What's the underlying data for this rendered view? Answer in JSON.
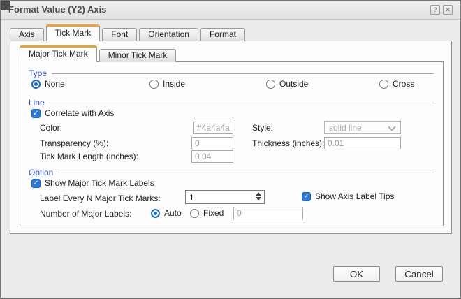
{
  "window": {
    "title": "Format Value (Y2) Axis"
  },
  "icons": {
    "help": "?",
    "close": "✕",
    "check": "✓"
  },
  "tabs": [
    {
      "label": "Axis"
    },
    {
      "label": "Tick Mark"
    },
    {
      "label": "Font"
    },
    {
      "label": "Orientation"
    },
    {
      "label": "Format"
    }
  ],
  "active_tab": "Tick Mark",
  "subtabs": [
    {
      "label": "Major Tick Mark"
    },
    {
      "label": "Minor Tick Mark"
    }
  ],
  "active_subtab": "Major Tick Mark",
  "type_group": {
    "title": "Type",
    "options": [
      {
        "label": "None",
        "selected": true
      },
      {
        "label": "Inside",
        "selected": false
      },
      {
        "label": "Outside",
        "selected": false
      },
      {
        "label": "Cross",
        "selected": false
      }
    ]
  },
  "line_group": {
    "title": "Line",
    "correlate": {
      "label": "Correlate with Axis",
      "checked": true
    },
    "color": {
      "label": "Color:",
      "swatch": "#4a4a4a",
      "swatch_style": "background:#4a4a4a",
      "value": "#4a4a4a"
    },
    "style": {
      "label": "Style:",
      "value": "solid line",
      "disabled": true
    },
    "transparency": {
      "label": "Transparency (%):",
      "value": "0"
    },
    "thickness": {
      "label": "Thickness (inches):",
      "value": "0.01"
    },
    "tick_length": {
      "label": "Tick Mark Length (inches):",
      "value": "0.04"
    }
  },
  "option_group": {
    "title": "Option",
    "show_labels": {
      "label": "Show Major Tick Mark Labels",
      "checked": true
    },
    "label_every": {
      "label": "Label Every N Major Tick Marks:",
      "value": "1"
    },
    "axis_tips": {
      "label": "Show Axis Label Tips",
      "checked": true
    },
    "major_labels": {
      "label": "Number of Major Labels:",
      "auto": {
        "label": "Auto",
        "selected": true
      },
      "fixed": {
        "label": "Fixed",
        "selected": false
      },
      "fixed_value": "0"
    }
  },
  "buttons": {
    "ok": "OK",
    "cancel": "Cancel"
  },
  "colors": {
    "accent_blue": "#2878e0",
    "group_label_blue": "#3353d9",
    "active_tab_orange": "#f0a030",
    "swatch": "#4a4a4a"
  }
}
